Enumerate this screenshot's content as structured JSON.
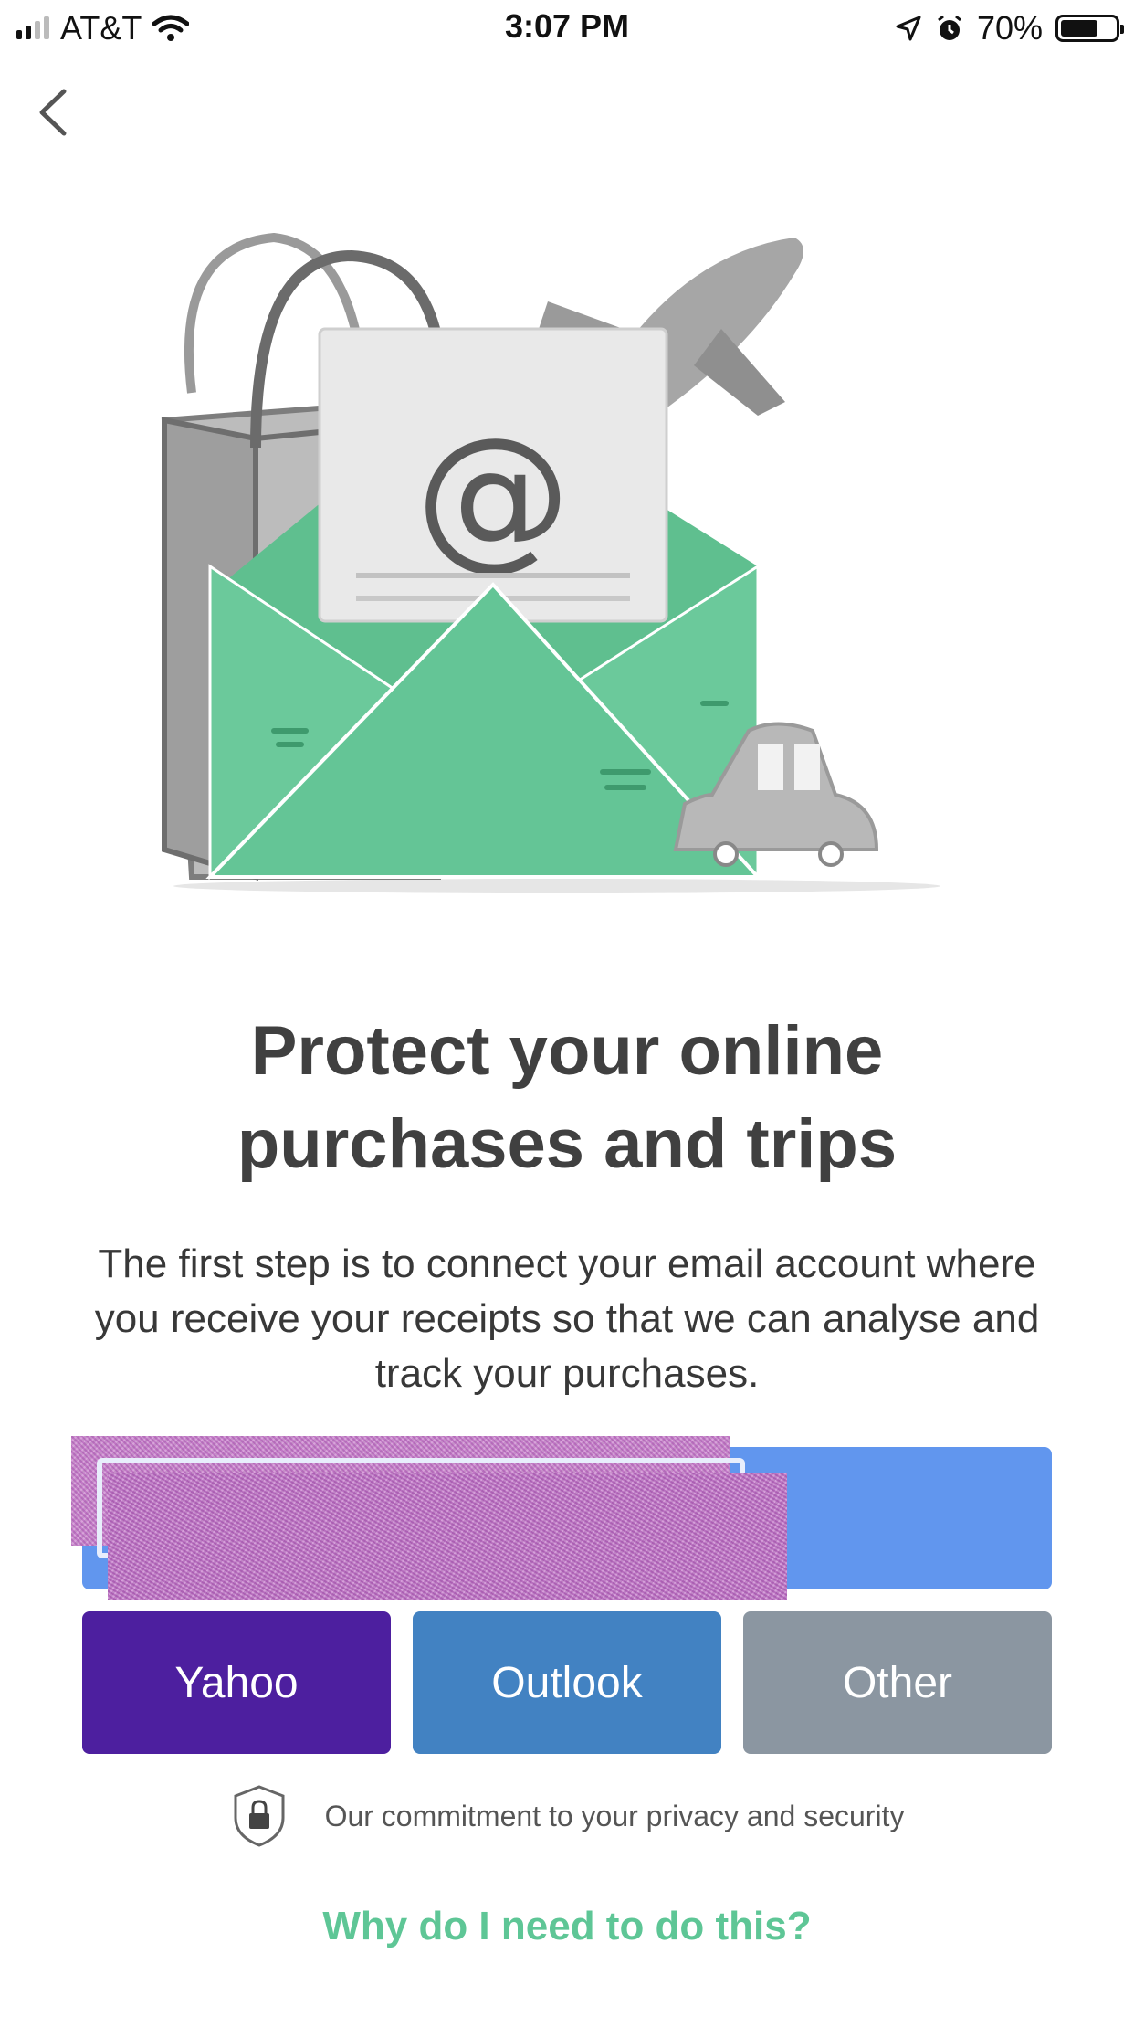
{
  "status_bar": {
    "carrier": "AT&T",
    "time": "3:07 PM",
    "battery_percent": "70%",
    "battery_level": 0.7
  },
  "nav": {
    "back_icon": "chevron-left-icon"
  },
  "hero": {
    "title": "Protect your online purchases and trips",
    "description": "The first step is to connect your email account where you receive your receipts so that we can analyse and track your purchases."
  },
  "providers": {
    "yahoo_label": "Yahoo",
    "outlook_label": "Outlook",
    "other_label": "Other"
  },
  "colors": {
    "primary_blue": "#6196ee",
    "yahoo": "#4d1f9f",
    "outlook": "#4282c2",
    "other": "#8b96a1",
    "link_green": "#5ec696",
    "envelope_green": "#64c596"
  },
  "privacy": {
    "icon": "shield-lock-icon",
    "text": "Our commitment to your privacy and security"
  },
  "footer": {
    "why_link": "Why do I need to do this?"
  }
}
